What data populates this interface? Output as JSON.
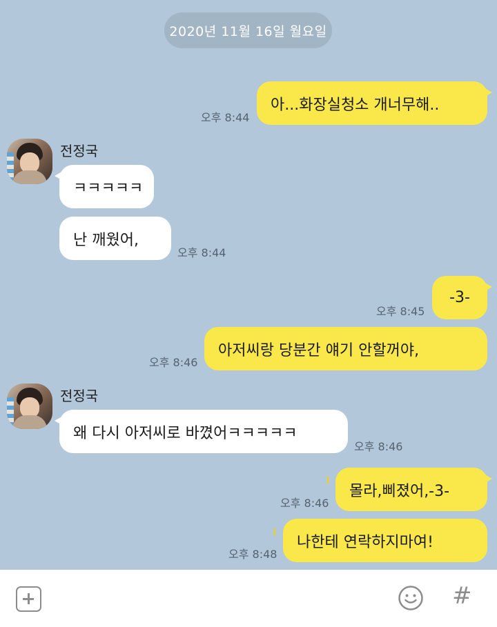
{
  "date_divider": "2020년 11월 16일 월요일",
  "contact": {
    "name": "전정국",
    "avatar": "profile-photo"
  },
  "messages": [
    {
      "from": "me",
      "text": "아...화장실청소 개너무해..",
      "time": "오후 8:44"
    },
    {
      "from": "other",
      "text": "ㅋㅋㅋㅋㅋ",
      "time": ""
    },
    {
      "from": "other",
      "text": "난 깨웠어,",
      "time": "오후 8:44"
    },
    {
      "from": "me",
      "text": "-3-",
      "time": "오후 8:45"
    },
    {
      "from": "me",
      "text": "아저씨랑 당분간 얘기 안할꺼야,",
      "time": "오후 8:46"
    },
    {
      "from": "other",
      "text": "왜 다시 아저씨로 바꼈어ㅋㅋㅋㅋㅋ",
      "time": "오후 8:46"
    },
    {
      "from": "me",
      "text": "몰라,삐졌어,-3-",
      "time": "오후 8:46",
      "unread": "1"
    },
    {
      "from": "me",
      "text": "나한테 연락하지마여!",
      "time": "오후 8:48",
      "unread": "1"
    }
  ],
  "composer": {
    "plus_icon": "plus-square-icon",
    "emoji_icon": "smiley-icon",
    "hash_label": "#"
  },
  "colors": {
    "background": "#b2c7da",
    "my_bubble": "#fae84a",
    "other_bubble": "#ffffff"
  }
}
